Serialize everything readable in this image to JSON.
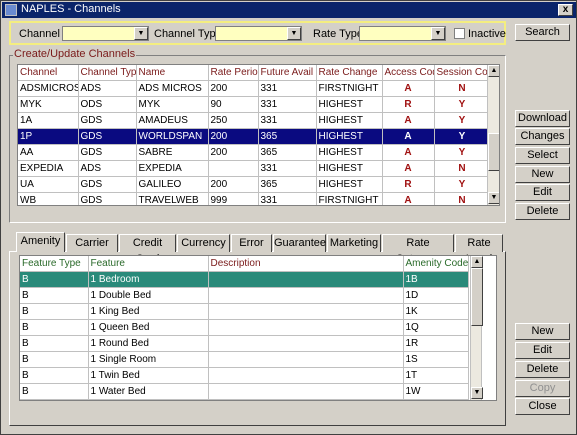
{
  "window": {
    "title": "NAPLES - Channels",
    "close": "x"
  },
  "filter": {
    "channel_label": "Channel",
    "channel_type_label": "Channel Type",
    "rate_type_label": "Rate Type",
    "inactive_label": "Inactive",
    "channel_value": "",
    "channel_type_value": "",
    "rate_type_value": "",
    "inactive_checked": false
  },
  "group_label": "Create/Update Channels",
  "channels": {
    "columns": [
      "Channel",
      "Channel Type",
      "Name",
      "Rate Period",
      "Future Avail D",
      "Rate Change",
      "Access Cod",
      "Session Co"
    ],
    "rows": [
      [
        "ADSMICROS",
        "ADS",
        "ADS MICROS",
        "200",
        "331",
        "FIRSTNIGHT",
        "A",
        "N"
      ],
      [
        "MYK",
        "ODS",
        "MYK",
        "90",
        "331",
        "HIGHEST",
        "R",
        "Y"
      ],
      [
        "1A",
        "GDS",
        "AMADEUS",
        "250",
        "331",
        "HIGHEST",
        "A",
        "Y"
      ],
      [
        "1P",
        "GDS",
        "WORLDSPAN",
        "200",
        "365",
        "HIGHEST",
        "A",
        "Y"
      ],
      [
        "AA",
        "GDS",
        "SABRE",
        "200",
        "365",
        "HIGHEST",
        "A",
        "Y"
      ],
      [
        "EXPEDIA",
        "ADS",
        "EXPEDIA",
        "",
        "331",
        "HIGHEST",
        "A",
        "N"
      ],
      [
        "UA",
        "GDS",
        "GALILEO",
        "200",
        "365",
        "HIGHEST",
        "R",
        "Y"
      ],
      [
        "WB",
        "GDS",
        "TRAVELWEB",
        "999",
        "331",
        "FIRSTNIGHT",
        "A",
        "N"
      ]
    ],
    "selected_row": 3
  },
  "top_buttons": {
    "search": "Search",
    "download": "Download",
    "changes": "Changes",
    "select": "Select",
    "new": "New",
    "edit": "Edit",
    "delete": "Delete"
  },
  "tabs": [
    "Amenity",
    "Carrier",
    "Credit Card",
    "Currency",
    "Error",
    "Guarantee",
    "Marketing",
    "Rate Category",
    "Rate Level"
  ],
  "active_tab": 0,
  "amenities": {
    "columns": [
      "Feature Type",
      "Feature",
      "Description",
      "Amenity Code"
    ],
    "rows": [
      [
        "B",
        "1 Bedroom",
        "",
        "1B"
      ],
      [
        "B",
        "1 Double Bed",
        "",
        "1D"
      ],
      [
        "B",
        "1 King Bed",
        "",
        "1K"
      ],
      [
        "B",
        "1 Queen Bed",
        "",
        "1Q"
      ],
      [
        "B",
        "1 Round Bed",
        "",
        "1R"
      ],
      [
        "B",
        "1 Single Room",
        "",
        "1S"
      ],
      [
        "B",
        "1 Twin Bed",
        "",
        "1T"
      ],
      [
        "B",
        "1 Water Bed",
        "",
        "1W"
      ]
    ],
    "selected_row": 0
  },
  "bottom_buttons": {
    "new": "New",
    "edit": "Edit",
    "delete": "Delete",
    "copy": "Copy",
    "close": "Close"
  }
}
